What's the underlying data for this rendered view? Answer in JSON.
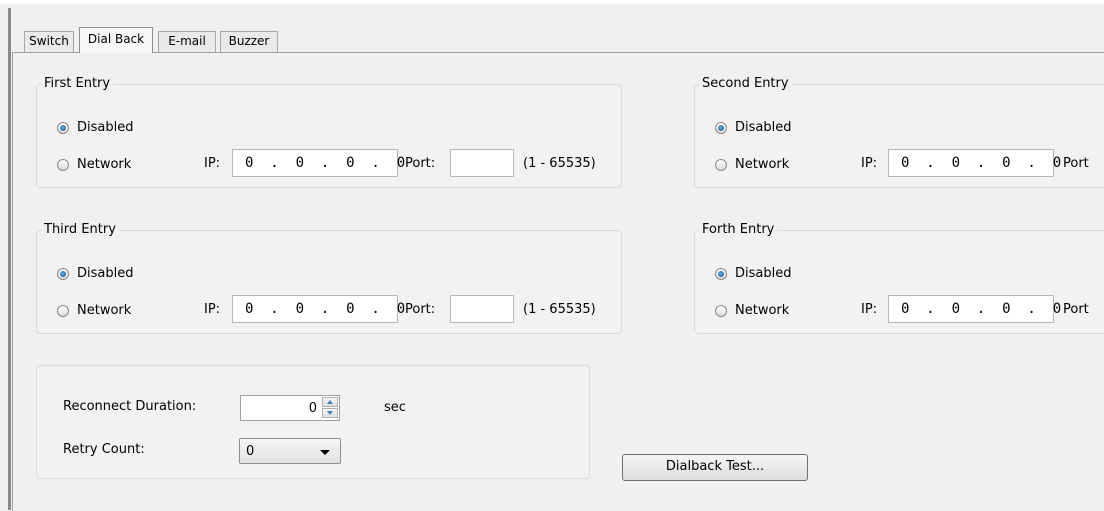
{
  "tabs": [
    "Switch",
    "Dial Back",
    "E-mail",
    "Buzzer"
  ],
  "active_tab": "Dial Back",
  "entries": [
    {
      "title": "First Entry",
      "disabled_label": "Disabled",
      "network_label": "Network",
      "ip_label": "IP:",
      "ip_value": "0  .  0  .  0  .  0",
      "port_label": "Port:",
      "port_value": "",
      "range": "(1 - 65535)",
      "selected": "Disabled"
    },
    {
      "title": "Second Entry",
      "disabled_label": "Disabled",
      "network_label": "Network",
      "ip_label": "IP:",
      "ip_value": "0  .  0  .  0  .  0",
      "port_label": "Port",
      "selected": "Disabled"
    },
    {
      "title": "Third Entry",
      "disabled_label": "Disabled",
      "network_label": "Network",
      "ip_label": "IP:",
      "ip_value": "0  .  0  .  0  .  0",
      "port_label": "Port:",
      "port_value": "",
      "range": "(1 - 65535)",
      "selected": "Disabled"
    },
    {
      "title": "Forth Entry",
      "disabled_label": "Disabled",
      "network_label": "Network",
      "ip_label": "IP:",
      "ip_value": "0  .  0  .  0  .  0",
      "port_label": "Port",
      "selected": "Disabled"
    }
  ],
  "settings": {
    "reconnect_label": "Reconnect Duration:",
    "reconnect_value": "0",
    "reconnect_unit": "sec",
    "retry_label": "Retry Count:",
    "retry_value": "0"
  },
  "dialback_test_label": "Dialback Test..."
}
